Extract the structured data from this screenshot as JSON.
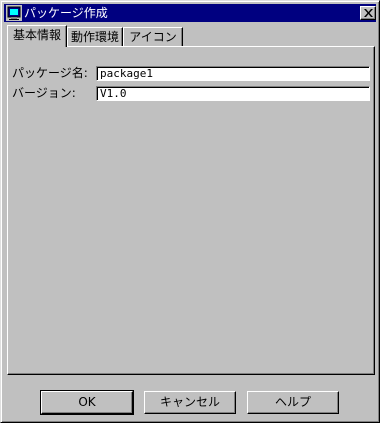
{
  "window": {
    "title": "パッケージ作成",
    "icon": "app-icon",
    "close_icon": "close-icon"
  },
  "tabs": [
    {
      "label": "基本情報",
      "active": true
    },
    {
      "label": "動作環境",
      "active": false
    },
    {
      "label": "アイコン",
      "active": false
    }
  ],
  "form": {
    "package_name": {
      "label": "パッケージ名:",
      "value": "package1"
    },
    "version": {
      "label": "バージョン:",
      "value": "V1.0"
    }
  },
  "buttons": {
    "ok": "OK",
    "cancel": "キャンセル",
    "help": "ヘルプ"
  },
  "colors": {
    "title_bar": "#000080",
    "face": "#c0c0c0",
    "field_bg": "#ffffff"
  }
}
